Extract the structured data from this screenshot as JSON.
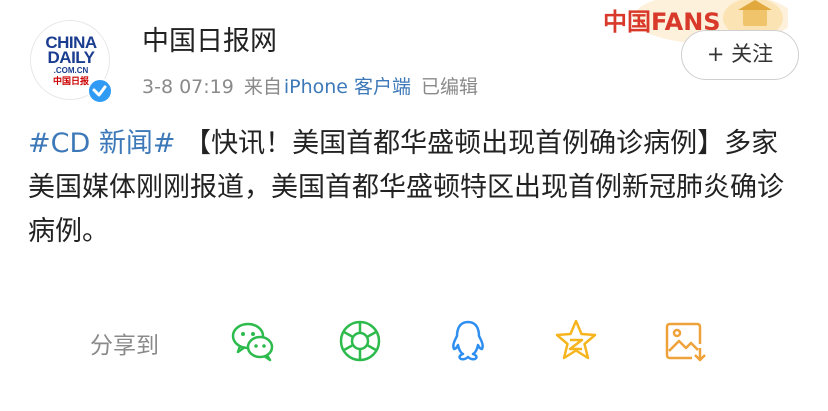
{
  "header": {
    "avatar_logo": {
      "line1": "CHINA",
      "line2": "DAILY",
      "line3": ".COM.CN",
      "line4": "中国日报"
    },
    "username": "中国日报网",
    "date": "3-8 07:19",
    "source_prefix": "来自",
    "source_client": "iPhone 客户端",
    "edited": "已编辑",
    "fans_badge": "中国FANS",
    "follow_label": "+ 关注"
  },
  "post": {
    "topic": "#CD 新闻#",
    "text": " 【快讯！美国首都华盛顿出现首例确诊病例】多家美国媒体刚刚报道，美国首都华盛顿特区出现首例新冠肺炎确诊病例。"
  },
  "share": {
    "label": "分享到",
    "targets": [
      "wechat-icon",
      "moments-icon",
      "qq-icon",
      "qzone-icon",
      "save-image-icon"
    ]
  },
  "colors": {
    "link": "#3d79b8",
    "meta": "#8a8a8a",
    "icon_green": "#2dbb4d",
    "icon_blue": "#2f8ff0",
    "icon_yellow": "#f6b51e",
    "icon_orange": "#f0a23a",
    "verified": "#2f9bf4"
  }
}
